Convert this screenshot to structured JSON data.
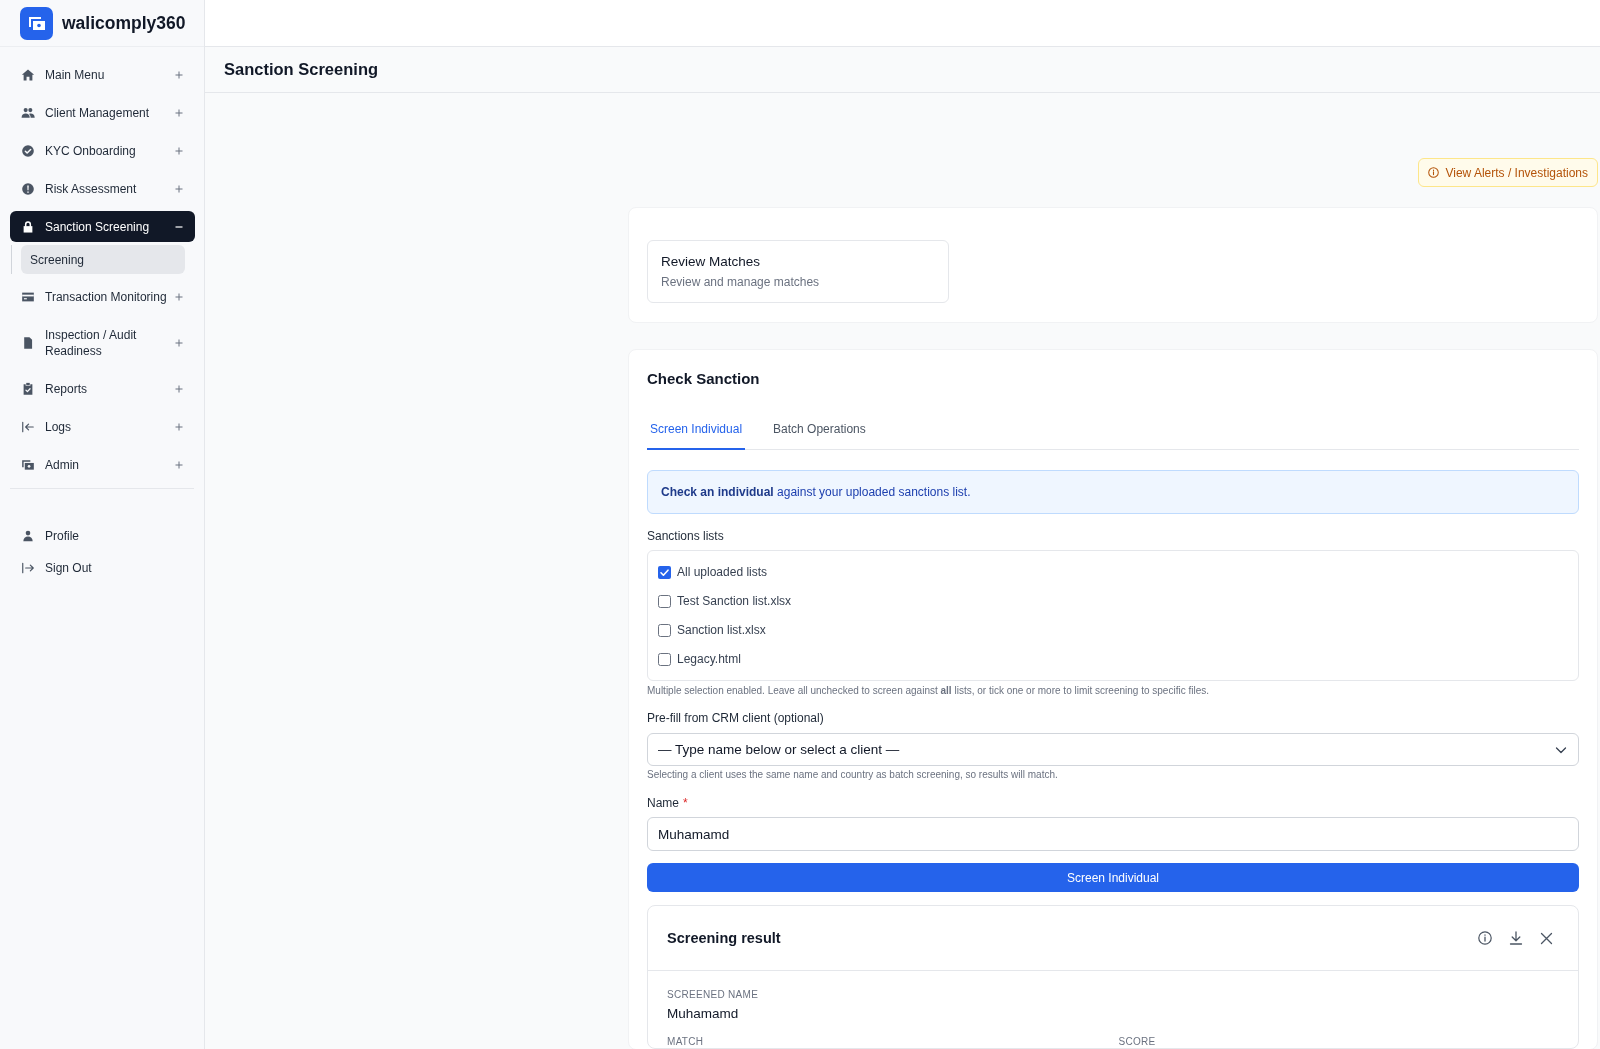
{
  "app": {
    "name": "walicomply360"
  },
  "sidebar": {
    "items": [
      {
        "label": "Main Menu",
        "selected": false,
        "expanded": false
      },
      {
        "label": "Client Management",
        "selected": false,
        "expanded": false
      },
      {
        "label": "KYC Onboarding",
        "selected": false,
        "expanded": false
      },
      {
        "label": "Risk Assessment",
        "selected": false,
        "expanded": false
      },
      {
        "label": "Sanction Screening",
        "selected": true,
        "expanded": true,
        "children": [
          {
            "label": "Screening",
            "selected": true
          }
        ]
      },
      {
        "label": "Transaction Monitoring",
        "selected": false,
        "expanded": false
      },
      {
        "label": "Inspection / Audit Readiness",
        "selected": false,
        "expanded": false
      },
      {
        "label": "Reports",
        "selected": false,
        "expanded": false
      },
      {
        "label": "Logs",
        "selected": false,
        "expanded": false
      },
      {
        "label": "Admin",
        "selected": false,
        "expanded": false
      }
    ],
    "account_items": [
      {
        "label": "Profile"
      },
      {
        "label": "Sign Out"
      }
    ]
  },
  "page_header": {
    "title": "Sanction Screening"
  },
  "alerts_button": {
    "label": "View Alerts / Investigations"
  },
  "shortcuts": [
    {
      "title": "Review Matches",
      "subtitle": "Review and manage matches"
    }
  ],
  "check_sanction": {
    "title": "Check Sanction",
    "tabs": [
      {
        "label": "Screen Individual",
        "selected": true
      },
      {
        "label": "Batch Operations",
        "selected": false
      }
    ],
    "notice": "**Check an individual** against your uploaded sanctions list.",
    "sanctions_lists": {
      "label": "Sanctions lists",
      "options": [
        {
          "label": "All uploaded lists",
          "checked": true
        },
        {
          "label": "Test Sanction list.xlsx",
          "checked": false
        },
        {
          "label": "Sanction list.xlsx",
          "checked": false
        },
        {
          "label": "Legacy.html",
          "checked": false
        }
      ],
      "hint": "Multiple selection enabled. Leave all unchecked to screen against **all** lists, or tick one or more to limit screening to specific files."
    },
    "crm_client": {
      "label": "Pre-fill from CRM client (optional)",
      "selected_option": "— Type name below or select a client —",
      "hint": "Selecting a client uses the same name and country as batch screening, so results will match."
    },
    "name": {
      "label": "Name",
      "required_mark": "*",
      "value": "Muhamamd"
    },
    "submit_button": "Screen Individual"
  },
  "screening_result": {
    "title": "Screening result",
    "fields": [
      {
        "label": "SCREENED NAME",
        "value": "Muhamamd"
      }
    ],
    "columns": [
      {
        "label": "MATCH"
      },
      {
        "label": "SCORE"
      }
    ]
  }
}
